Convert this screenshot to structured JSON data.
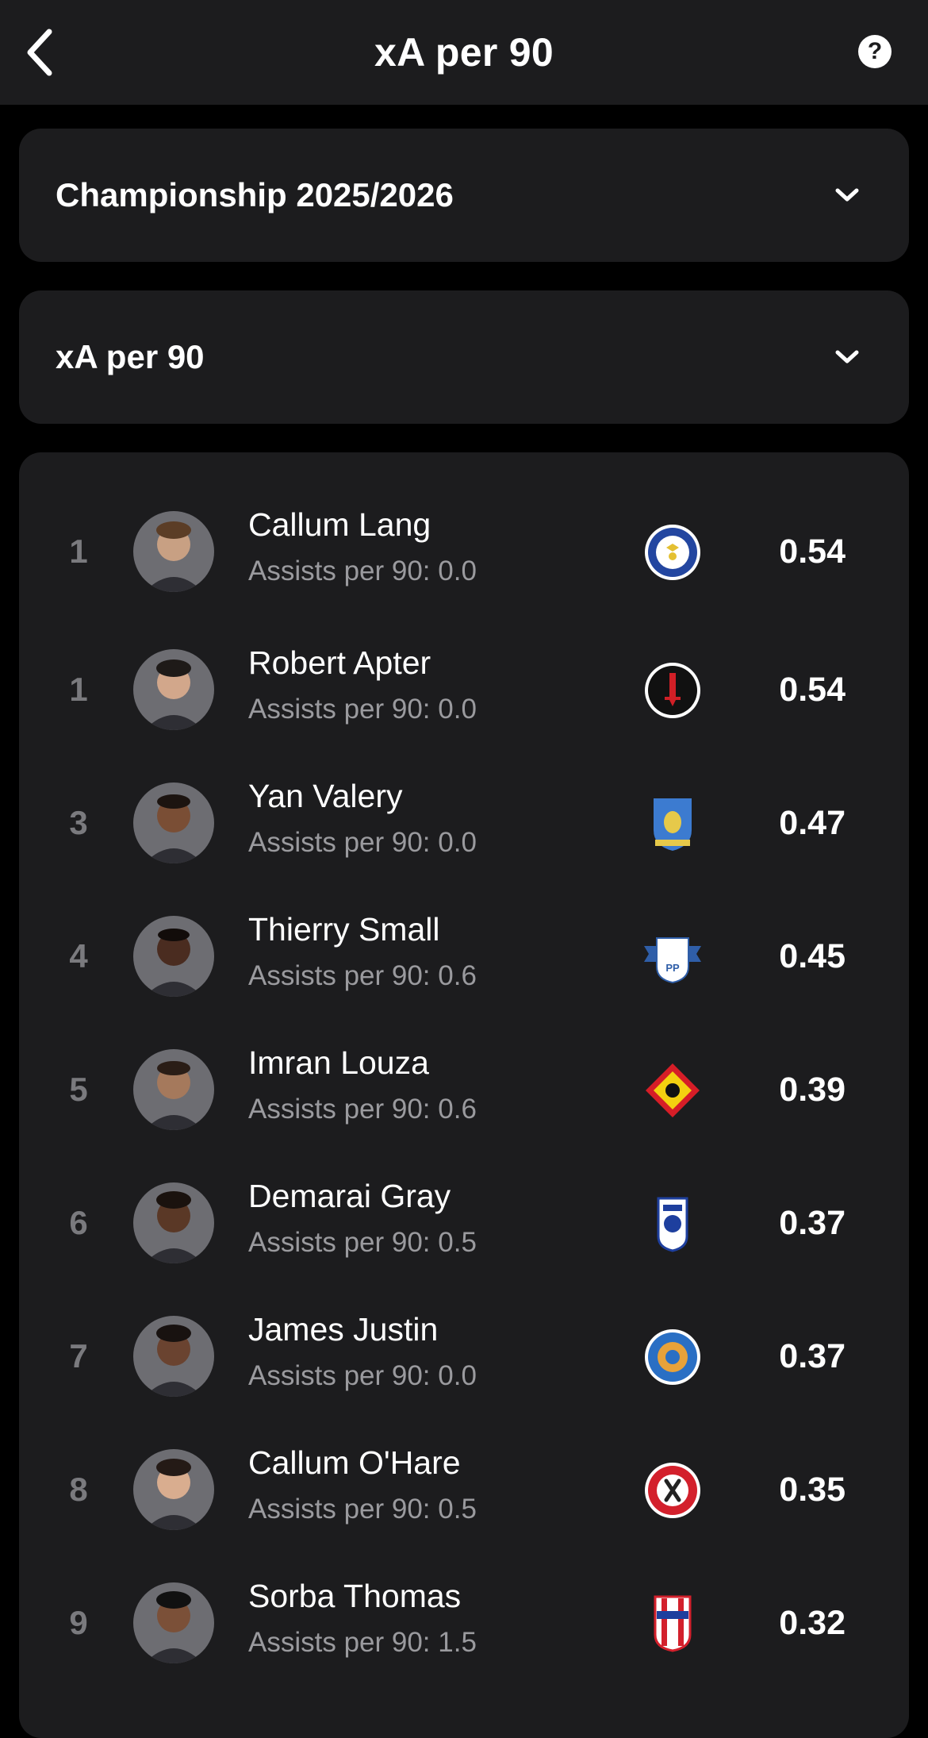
{
  "header": {
    "title": "xA per 90",
    "help_symbol": "?"
  },
  "filters": {
    "season": "Championship 2025/2026",
    "stat": "xA per 90"
  },
  "players": [
    {
      "rank": "1",
      "name": "Callum Lang",
      "sub": "Assists per 90: 0.0",
      "value": "0.54",
      "club_icon": "portsmouth-crest-icon"
    },
    {
      "rank": "1",
      "name": "Robert Apter",
      "sub": "Assists per 90: 0.0",
      "value": "0.54",
      "club_icon": "charlton-crest-icon"
    },
    {
      "rank": "3",
      "name": "Yan Valery",
      "sub": "Assists per 90: 0.0",
      "value": "0.47",
      "club_icon": "sheffield-wednesday-crest-icon"
    },
    {
      "rank": "4",
      "name": "Thierry Small",
      "sub": "Assists per 90: 0.6",
      "value": "0.45",
      "club_icon": "preston-crest-icon"
    },
    {
      "rank": "5",
      "name": "Imran Louza",
      "sub": "Assists per 90: 0.6",
      "value": "0.39",
      "club_icon": "watford-crest-icon"
    },
    {
      "rank": "6",
      "name": "Demarai Gray",
      "sub": "Assists per 90: 0.5",
      "value": "0.37",
      "club_icon": "birmingham-crest-icon"
    },
    {
      "rank": "7",
      "name": "James Justin",
      "sub": "Assists per 90: 0.0",
      "value": "0.37",
      "club_icon": "leicester-crest-icon"
    },
    {
      "rank": "8",
      "name": "Callum O'Hare",
      "sub": "Assists per 90: 0.5",
      "value": "0.35",
      "club_icon": "sheffield-united-crest-icon"
    },
    {
      "rank": "9",
      "name": "Sorba Thomas",
      "sub": "Assists per 90: 1.5",
      "value": "0.32",
      "club_icon": "stoke-crest-icon"
    }
  ],
  "colors": {
    "background": "#000000",
    "card": "#1c1c1e",
    "rank": "#7a7a7e",
    "subtext": "#9a9a9e"
  }
}
